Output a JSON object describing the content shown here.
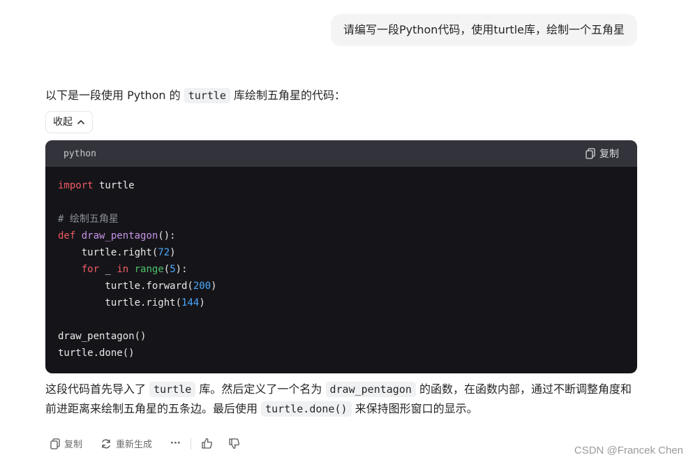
{
  "user_message": "请编写一段Python代码，使用turtle库，绘制一个五角星",
  "reply": {
    "intro_before": "以下是一段使用 Python 的",
    "intro_code": "turtle",
    "intro_after": "库绘制五角星的代码：",
    "collapse_label": "收起",
    "code": {
      "language": "python",
      "copy_label": "复制",
      "lines": {
        "l1_kw": "import",
        "l1_rest": " turtle",
        "l3_comment": "# 绘制五角星",
        "l4_kw": "def",
        "l4_fn": "draw_pentagon",
        "l4_rest": "():",
        "l5_a": "    turtle.right(",
        "l5_num": "72",
        "l5_b": ")",
        "l6_indent": "    ",
        "l6_for": "for",
        "l6_mid": " _ ",
        "l6_in": "in",
        "l6_sp": " ",
        "l6_range": "range",
        "l6_a": "(",
        "l6_num": "5",
        "l6_b": "):",
        "l7_a": "        turtle.forward(",
        "l7_num": "200",
        "l7_b": ")",
        "l8_a": "        turtle.right(",
        "l8_num": "144",
        "l8_b": ")",
        "l10": "draw_pentagon()",
        "l11": "turtle.done()"
      }
    },
    "explanation": {
      "p1": "这段代码首先导入了",
      "c1": "turtle",
      "p2": "库。然后定义了一个名为",
      "c2": "draw_pentagon",
      "p3": "的函数，在函数内部，通过不断调整角度和前进距离来绘制五角星的五条边。最后使用",
      "c3": "turtle.done()",
      "p4": "来保持图形窗口的显示。"
    },
    "actions": {
      "copy": "复制",
      "regenerate": "重新生成",
      "more": "···"
    }
  },
  "watermark": "CSDN @Francek Chen",
  "colors": {
    "code_bg": "#151519",
    "code_header_bg": "#33343b",
    "keyword": "#f05a64",
    "function": "#c792ea",
    "number": "#4aa8ff",
    "builtin": "#4ec16a"
  }
}
